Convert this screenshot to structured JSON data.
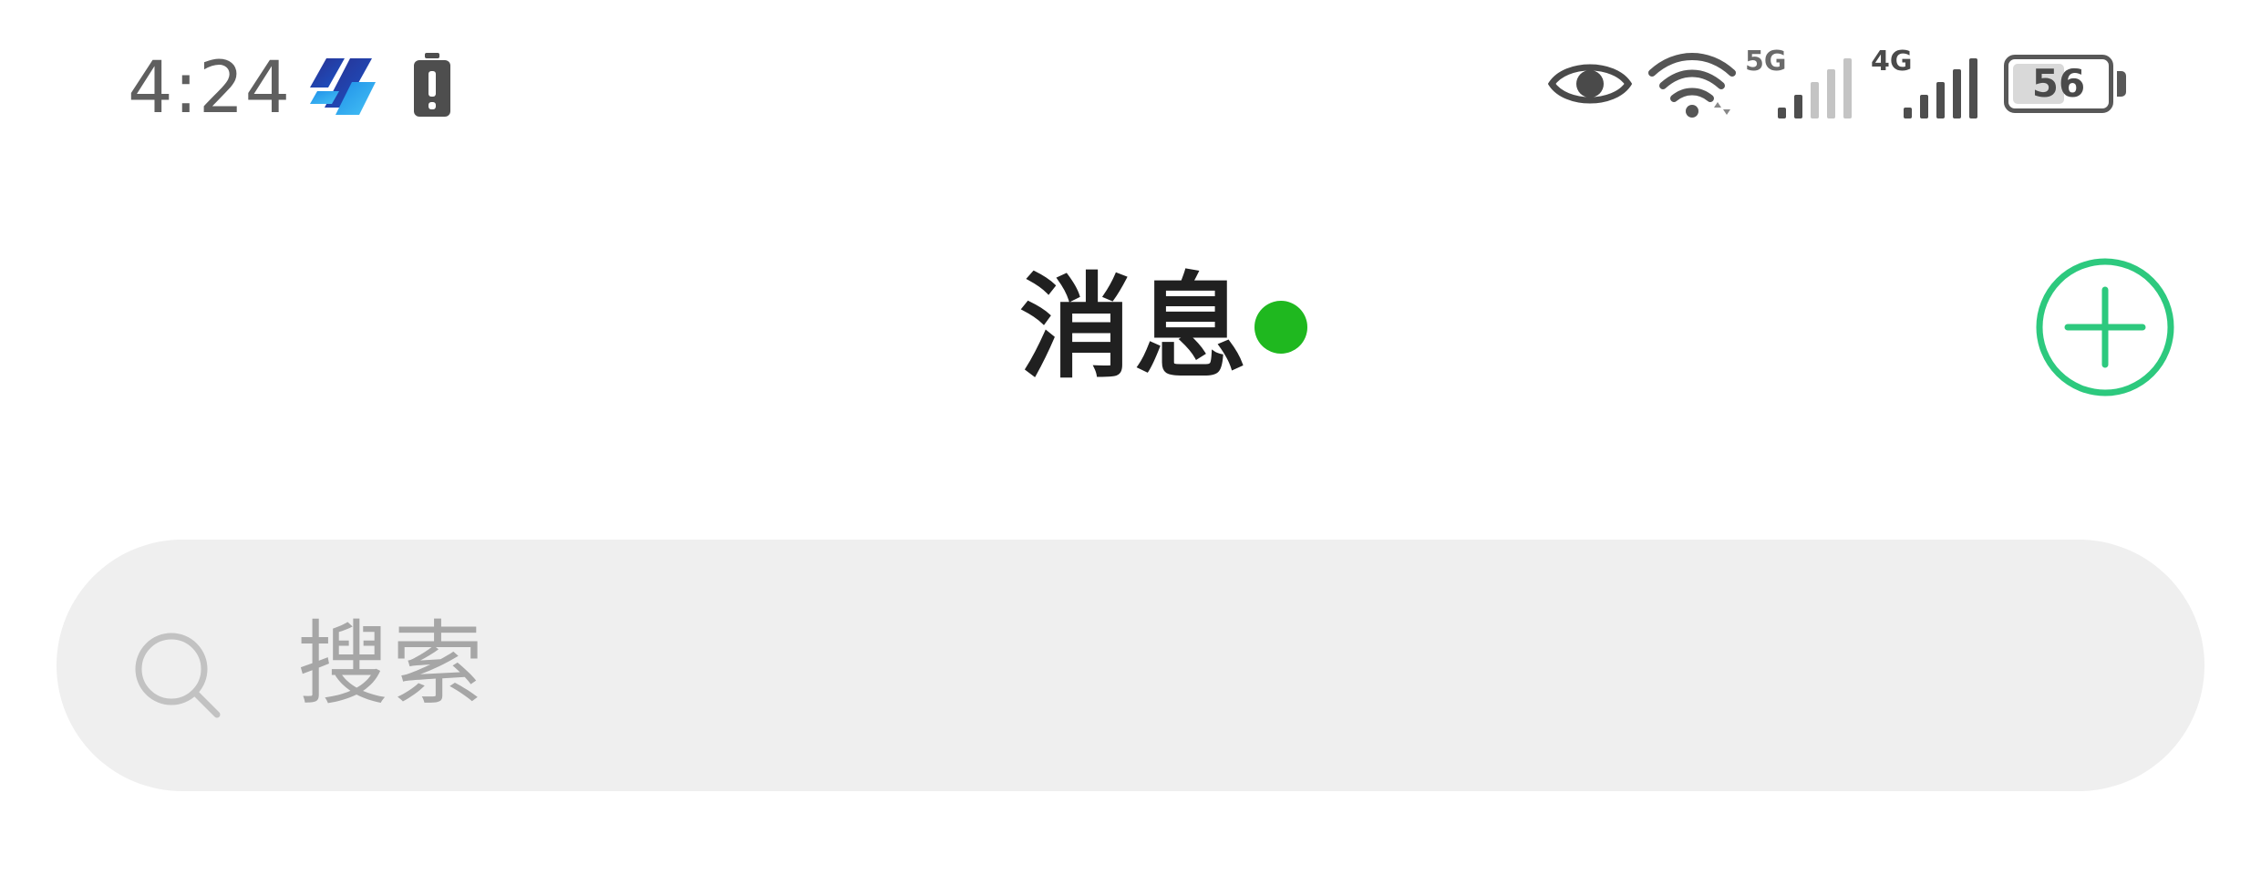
{
  "status_bar": {
    "time": "4:24",
    "network_5g_label": "5G",
    "network_4g_label": "4G",
    "battery_level": "56",
    "battery_percent": 56,
    "icons": [
      "app-logo-icon",
      "battery-alert-icon",
      "eye-icon",
      "wifi-icon",
      "signal-5g-icon",
      "signal-4g-icon",
      "battery-icon"
    ]
  },
  "header": {
    "title": "消息",
    "status_dot_color": "#1fb81f",
    "add_button_icon": "plus-circle-icon",
    "accent_color": "#2dc97e"
  },
  "search": {
    "placeholder": "搜索",
    "icon": "search-icon"
  }
}
